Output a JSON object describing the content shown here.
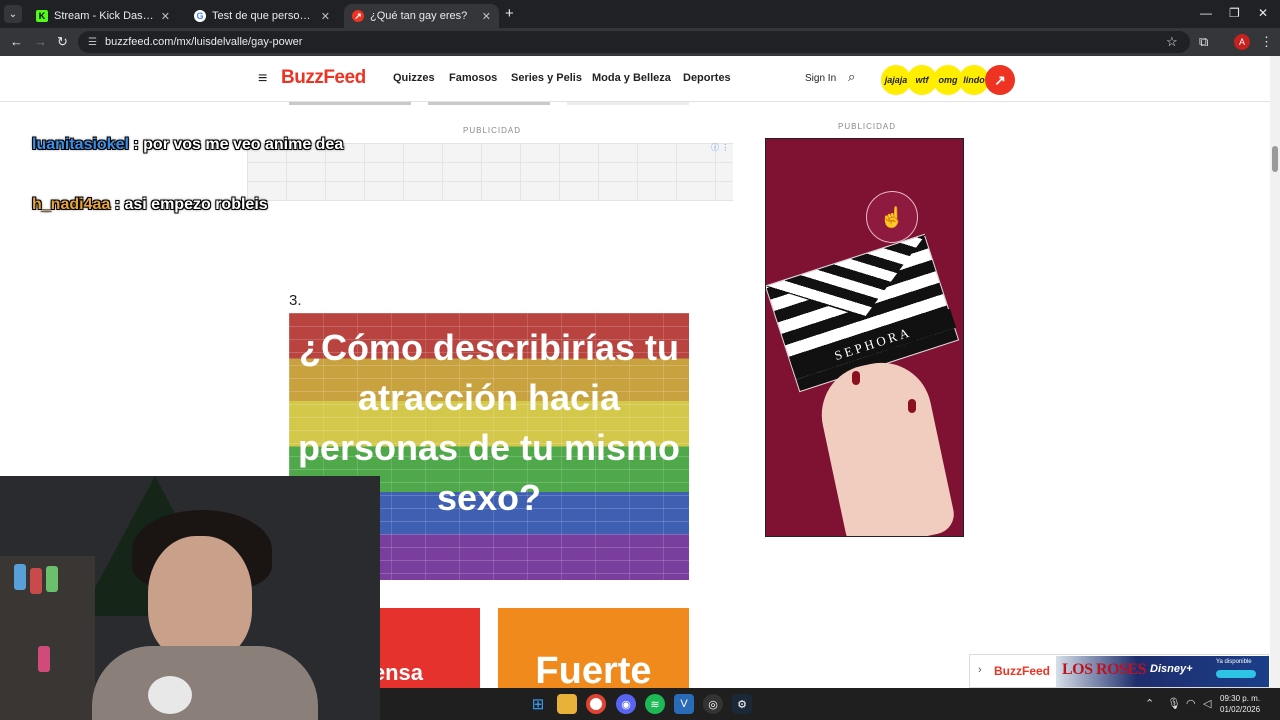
{
  "browser": {
    "tabs": [
      {
        "title": "Stream - Kick Dashboard",
        "favicon": "kick-icon",
        "active": false
      },
      {
        "title": "Test de que personaje eres de anime",
        "favicon": "google-icon",
        "active": false
      },
      {
        "title": "¿Qué tan gay eres?",
        "favicon": "buzzfeed-icon",
        "active": true
      }
    ],
    "url": "buzzfeed.com/mx/luisdelvalle/gay-power",
    "profile_initial": "A"
  },
  "site": {
    "logo": "BuzzFeed",
    "nav": [
      "Quizzes",
      "Famosos",
      "Series y Pelis",
      "Moda y Belleza",
      "Deportes"
    ],
    "sign_in": "Sign In",
    "badges": [
      "jajaja",
      "wtf",
      "omg",
      "lindo"
    ]
  },
  "ads": {
    "label": "PUBLICIDAD",
    "side_ad_brand": "SEPHORA",
    "float_logo": "BuzzFeed",
    "float_title": "LOS ROSES",
    "float_service": "Disney+",
    "float_tagline": "Ya disponible"
  },
  "question": {
    "number": "3.",
    "text": "¿Cómo describirías tu atracción hacia personas de tu mismo sexo?",
    "answers": [
      "Intensa",
      "Fuerte"
    ]
  },
  "stream_chat": [
    {
      "user": "luanitasiokel",
      "message": ": por vos me veo anime dea"
    },
    {
      "user": "h_nadi4aa",
      "message": ": asi empezo robleis"
    }
  ],
  "taskbar": {
    "time": "09:30 p. m.",
    "date": "01/02/2026"
  },
  "colors": {
    "buzzfeed_red": "#ee3322",
    "badge_yellow": "#ffee00",
    "answer_red": "#e5322d",
    "answer_orange": "#f08a1d",
    "sephora_bg": "#7f1133"
  }
}
